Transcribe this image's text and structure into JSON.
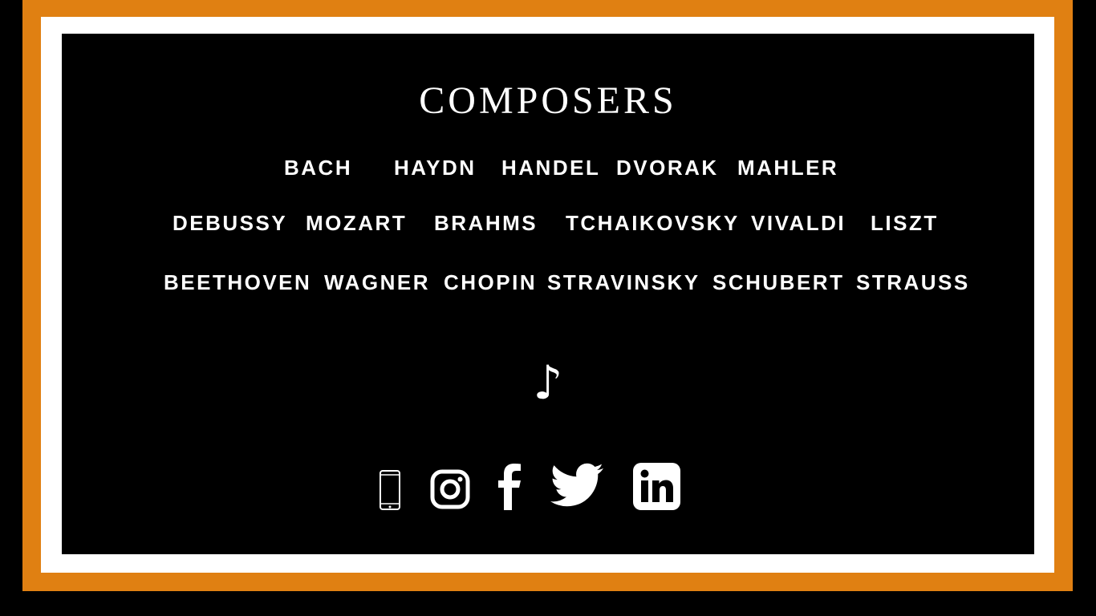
{
  "title": "COMPOSERS",
  "composer_rows": [
    [
      "BACH",
      "HAYDN",
      "HANDEL",
      "DVORAK",
      "MAHLER"
    ],
    [
      "DEBUSSY",
      "MOZART",
      "BRAHMS",
      "TCHAIKOVSKY",
      "VIVALDI",
      "LISZT"
    ],
    [
      "BEETHOVEN",
      "WAGNER",
      "CHOPIN",
      "STRAVINSKY",
      "SCHUBERT",
      "STRAUSS"
    ]
  ],
  "note_glyph": "♪",
  "social_icons": [
    "phone-icon",
    "instagram-icon",
    "facebook-icon",
    "twitter-icon",
    "linkedin-icon"
  ],
  "colors": {
    "border": "#e08012",
    "frame": "#ffffff",
    "background": "#000000",
    "text": "#ffffff"
  }
}
